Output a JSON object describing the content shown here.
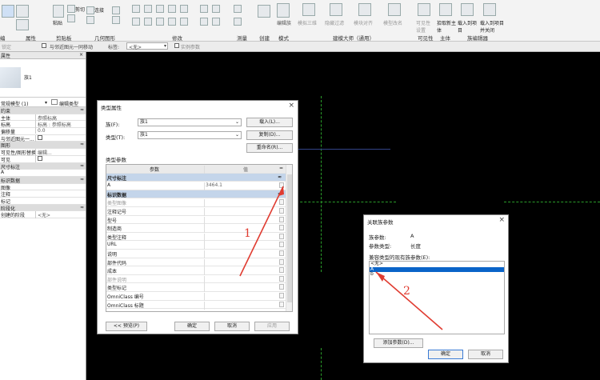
{
  "ribbon": {
    "panels": [
      "属性",
      "剪贴板",
      "几何图形",
      "修改",
      "测量",
      "创建",
      "模式",
      "建模大师（通用）",
      "可见性",
      "主体",
      "族编辑器"
    ],
    "tools": [
      "编辑族",
      "模拟三维",
      "隐藏过滤",
      "模块对齐",
      "模型改名",
      "可见性设置",
      "拾取新主体",
      "载入到项目",
      "载入到项目并关闭"
    ],
    "left_fragment": "编",
    "clip_items": [
      "剪切",
      "粘贴",
      "连接"
    ]
  },
  "options_bar": {
    "lock_label": "锁定",
    "move_with_nearby": "与邻近图元一同移动",
    "label_field": "标签:",
    "label_value": "<无>",
    "instance_param": "实例参数"
  },
  "properties": {
    "title": "属性",
    "close": "×",
    "type_name": "族1",
    "instance_selector": "常规模型 (1)",
    "edit_type": "编辑类型",
    "rows": [
      {
        "label": "约束",
        "value": "",
        "group": true,
        "toggle": "≈"
      },
      {
        "label": "主体",
        "value": "参照标高",
        "group": false
      },
      {
        "label": "标高",
        "value": "标高 : 参照标高",
        "group": false
      },
      {
        "label": "偏移量",
        "value": "0.0",
        "group": false
      },
      {
        "label": "与邻近图元一...",
        "value": "",
        "group": false,
        "check": true
      },
      {
        "label": "图形",
        "value": "",
        "group": true,
        "toggle": "≈"
      },
      {
        "label": "可见性/图形替换",
        "value": "编辑...",
        "group": false
      },
      {
        "label": "可见",
        "value": "",
        "group": false,
        "check": true
      },
      {
        "label": "尺寸标注",
        "value": "",
        "group": true,
        "toggle": "≈"
      },
      {
        "label": "A",
        "value": "",
        "group": false
      },
      {
        "label": "标识数据",
        "value": "",
        "group": true,
        "toggle": "≈"
      },
      {
        "label": "图像",
        "value": "",
        "group": false
      },
      {
        "label": "注释",
        "value": "",
        "group": false
      },
      {
        "label": "标记",
        "value": "",
        "group": false
      },
      {
        "label": "阶段化",
        "value": "",
        "group": true,
        "toggle": "≈"
      },
      {
        "label": "创建的阶段",
        "value": "<无>",
        "group": false
      }
    ]
  },
  "type_dialog": {
    "title": "类型属性",
    "family_label": "族(F):",
    "family_value": "族1",
    "type_label": "类型(T):",
    "type_value": "族1",
    "load_btn": "载入(L)...",
    "duplicate_btn": "复制(D)...",
    "rename_btn": "重命名(R)...",
    "section_label": "类型参数",
    "col_param": "参数",
    "col_value": "值",
    "rows": [
      {
        "label": "尺寸标注",
        "value": "",
        "group": true
      },
      {
        "label": "A",
        "value": "3464.1",
        "group": false
      },
      {
        "label": "标识数据",
        "value": "",
        "group": true
      },
      {
        "label": "类型图像",
        "value": "",
        "group": false,
        "disabled": true
      },
      {
        "label": "注释记号",
        "value": "",
        "group": false
      },
      {
        "label": "型号",
        "value": "",
        "group": false
      },
      {
        "label": "制造商",
        "value": "",
        "group": false
      },
      {
        "label": "类型注释",
        "value": "",
        "group": false
      },
      {
        "label": "URL",
        "value": "",
        "group": false
      },
      {
        "label": "说明",
        "value": "",
        "group": false
      },
      {
        "label": "部件代码",
        "value": "",
        "group": false
      },
      {
        "label": "成本",
        "value": "",
        "group": false
      },
      {
        "label": "部件说明",
        "value": "",
        "group": false,
        "disabled": true
      },
      {
        "label": "类型标记",
        "value": "",
        "group": false
      },
      {
        "label": "OmniClass 编号",
        "value": "",
        "group": false
      },
      {
        "label": "OmniClass 标题",
        "value": "",
        "group": false
      }
    ],
    "preview_btn": "<< 预览(P)",
    "ok_btn": "确定",
    "cancel_btn": "取消",
    "apply_btn": "应用"
  },
  "assoc_dialog": {
    "title": "关联族参数",
    "family_param_label": "族参数:",
    "family_param_value": "A",
    "param_type_label": "参数类型:",
    "param_type_value": "长度",
    "compatible_label": "兼容类型的现有族参数(E):",
    "options": [
      "<无>",
      "A",
      "b"
    ],
    "selected_index": 1,
    "add_param_btn": "添加参数(D)...",
    "ok_btn": "确定",
    "cancel_btn": "取消"
  },
  "annotations": {
    "num1": "1",
    "num2": "2",
    "color": "#e03c31"
  }
}
